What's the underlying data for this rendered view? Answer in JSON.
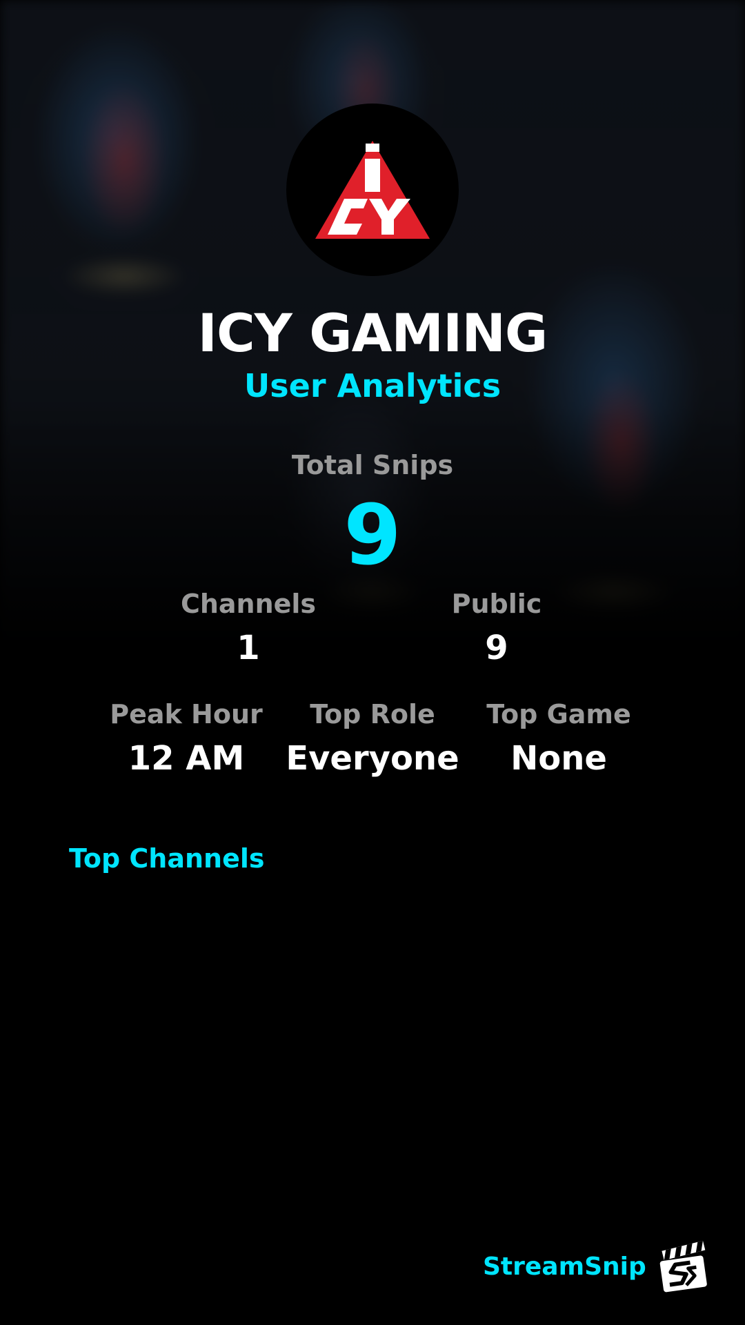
{
  "channel": {
    "name": "ICY GAMING",
    "subtitle": "User Analytics",
    "logo_text": "ICY"
  },
  "total_snips": {
    "label": "Total Snips",
    "value": "9"
  },
  "stats_row1": {
    "channels": {
      "label": "Channels",
      "value": "1"
    },
    "public": {
      "label": "Public",
      "value": "9"
    }
  },
  "stats_row2": {
    "peak_hour": {
      "label": "Peak Hour",
      "value": "12 AM"
    },
    "top_role": {
      "label": "Top Role",
      "value": "Everyone"
    },
    "top_game": {
      "label": "Top Game",
      "value": "None"
    }
  },
  "top_channels": {
    "title": "Top Channels",
    "items": []
  },
  "brand": {
    "name": "StreamSnip",
    "icon": "clapperboard-icon"
  },
  "colors": {
    "accent": "#00e5ff",
    "label_gray": "#9a9a9a",
    "background": "#000000",
    "logo_red": "#e0202a"
  }
}
